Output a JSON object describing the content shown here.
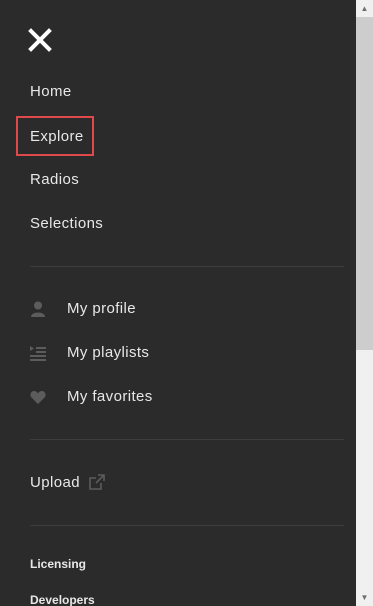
{
  "menu": {
    "close_icon": "close-icon",
    "primary": [
      {
        "label": "Home"
      },
      {
        "label": "Explore"
      },
      {
        "label": "Radios"
      },
      {
        "label": "Selections"
      }
    ],
    "account": [
      {
        "label": "My profile",
        "icon": "user-icon"
      },
      {
        "label": "My playlists",
        "icon": "playlist-icon"
      },
      {
        "label": "My favorites",
        "icon": "heart-icon"
      }
    ],
    "upload": {
      "label": "Upload",
      "icon": "external-link-icon"
    },
    "footer": [
      {
        "label": "Licensing"
      },
      {
        "label": "Developers"
      }
    ],
    "colors": {
      "background": "#2b2b2b",
      "text": "#e8e8e8",
      "icon": "#5c5c5c",
      "highlight_border": "#e0494a",
      "divider": "#3d3d3d"
    }
  }
}
